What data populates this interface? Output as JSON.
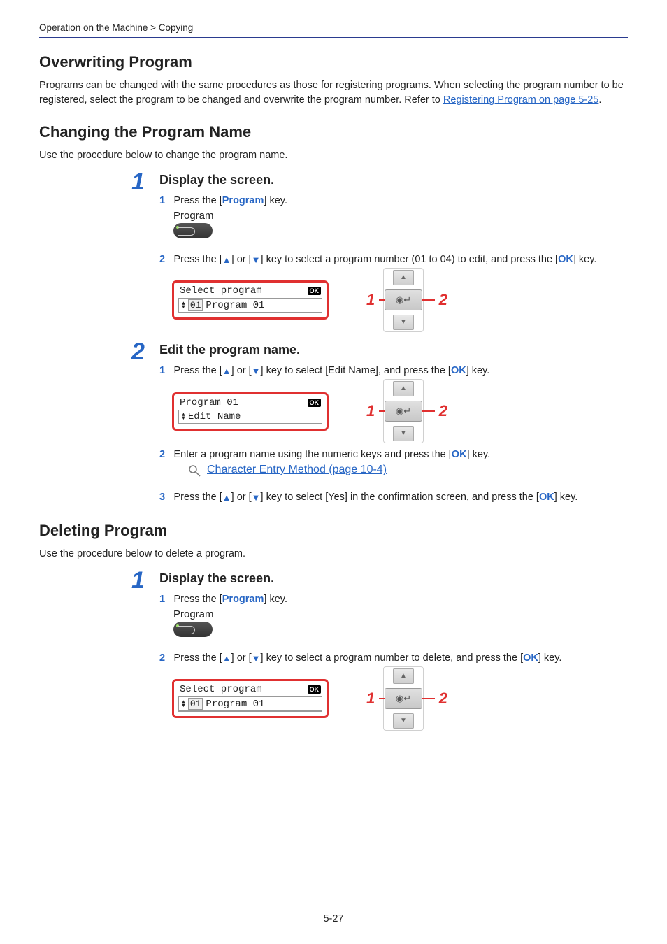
{
  "breadcrumb": "Operation on the Machine > Copying",
  "pageNumber": "5-27",
  "sections": {
    "overwriting": {
      "title": "Overwriting Program",
      "para_before_link": "Programs can be changed with the same procedures as those for registering programs. When selecting the program number to be registered, select the program to be changed and overwrite the program number. Refer to ",
      "link": "Registering Program on page 5-25",
      "para_after_link": "."
    },
    "changing": {
      "title": "Changing the Program Name",
      "intro": "Use the procedure below to change the program name.",
      "step1": {
        "heading": "Display the screen.",
        "sub1_a": "Press the [",
        "sub1_key": "Program",
        "sub1_b": "] key.",
        "keylabel": "Program",
        "sub2_a": "Press the [",
        "sub2_b": "] or [",
        "sub2_c": "] key to select a program number (01 to 04) to edit, and press the [",
        "sub2_ok": "OK",
        "sub2_d": "] key.",
        "lcd": {
          "title": "Select program",
          "row_num": "01",
          "row_text": "Program 01"
        }
      },
      "step2": {
        "heading": "Edit the program name.",
        "sub1_a": "Press the [",
        "sub1_b": "] or [",
        "sub1_c": "] key to select [Edit Name], and press the [",
        "sub1_ok": "OK",
        "sub1_d": "] key.",
        "lcd": {
          "title": "Program 01",
          "row_text": "Edit Name"
        },
        "sub2_a": "Enter a program name using the numeric keys and press the [",
        "sub2_ok": "OK",
        "sub2_b": "] key.",
        "maglink": "Character Entry Method (page 10-4)",
        "sub3_a": "Press the [",
        "sub3_b": "] or [",
        "sub3_c": "] key to select [Yes] in the confirmation screen, and press the [",
        "sub3_ok": "OK",
        "sub3_d": "] key."
      }
    },
    "deleting": {
      "title": "Deleting Program",
      "intro": "Use the procedure below to delete a program.",
      "step1": {
        "heading": "Display the screen.",
        "sub1_a": "Press the [",
        "sub1_key": "Program",
        "sub1_b": "] key.",
        "keylabel": "Program",
        "sub2_a": "Press the [",
        "sub2_b": "] or [",
        "sub2_c": "] key to select a program number to delete, and press the [",
        "sub2_ok": "OK",
        "sub2_d": "] key.",
        "lcd": {
          "title": "Select program",
          "row_num": "01",
          "row_text": "Program 01"
        }
      }
    }
  },
  "nums": {
    "s1": "1",
    "s2": "2",
    "s3": "3",
    "big1": "1",
    "big2": "2",
    "cal1": "1",
    "cal2": "2",
    "okchip": "OK"
  },
  "dpad": {
    "up": "▲",
    "mid": "◉↵",
    "down": "▼"
  }
}
